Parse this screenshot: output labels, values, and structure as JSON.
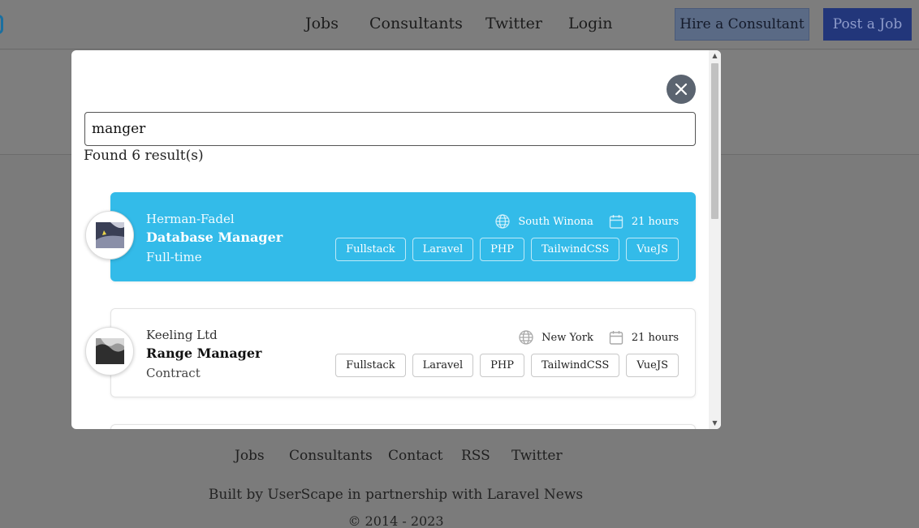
{
  "nav": {
    "links": [
      "Jobs",
      "Consultants",
      "Twitter",
      "Login"
    ],
    "hire_label": "Hire a Consultant",
    "post_label": "Post a Job"
  },
  "search": {
    "value": "manger",
    "result_count": "Found 6 result(s)"
  },
  "results": [
    {
      "company": "Herman-Fadel",
      "title": "Database Manager",
      "type": "Full-time",
      "location": "South Winona",
      "posted": "21 hours",
      "tags": [
        "Fullstack",
        "Laravel",
        "PHP",
        "TailwindCSS",
        "VueJS"
      ],
      "highlighted": true
    },
    {
      "company": "Keeling Ltd",
      "title": "Range Manager",
      "type": "Contract",
      "location": "New York",
      "posted": "21 hours",
      "tags": [
        "Fullstack",
        "Laravel",
        "PHP",
        "TailwindCSS",
        "VueJS"
      ],
      "highlighted": false
    }
  ],
  "footer": {
    "links": [
      "Jobs",
      "Consultants",
      "Contact",
      "RSS",
      "Twitter"
    ],
    "credit": "Built by UserScape in partnership with Laravel News",
    "copyright": "© 2014 - 2023"
  },
  "colors": {
    "highlight": "#33bbe9",
    "primary_button": "#1e3a8a",
    "overlay": "rgba(0,0,0,0.5)"
  },
  "icons": {
    "close": "close-icon",
    "location": "globe-icon",
    "posted": "calendar-icon"
  }
}
